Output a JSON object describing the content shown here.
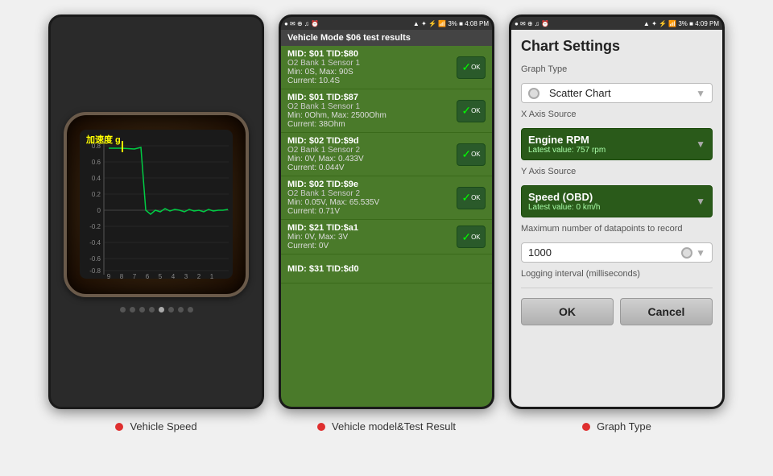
{
  "phone1": {
    "chart_title": "加速度 g",
    "y_labels": [
      "0.8",
      "0.6",
      "0.4",
      "0.2",
      "0",
      "−0.2",
      "−0.4",
      "−0.6",
      "−0.8"
    ],
    "x_labels": [
      "9",
      "8",
      "7",
      "6",
      "5",
      "4",
      "3",
      "2",
      "1"
    ],
    "dots": [
      false,
      false,
      false,
      false,
      true,
      false,
      false,
      false
    ]
  },
  "phone2": {
    "status_left": "●  ✉",
    "status_time": "4:08 PM",
    "status_signal": "3%■",
    "header": "Vehicle Mode $06 test results",
    "items": [
      {
        "mid": "MID: $01 TID:$80",
        "sensor": "O2 Bank 1 Sensor 1",
        "min_max": "Min: 0S, Max: 90S",
        "current": "Current: 10.4S",
        "has_ok": true
      },
      {
        "mid": "MID: $01 TID:$87",
        "sensor": "O2 Bank 1 Sensor 1",
        "min_max": "Min: 0Ohm, Max: 2500Ohm",
        "current": "Current: 38Ohm",
        "has_ok": true
      },
      {
        "mid": "MID: $02 TID:$9d",
        "sensor": "O2 Bank 1 Sensor 2",
        "min_max": "Min: 0V, Max: 0.433V",
        "current": "Current: 0.044V",
        "has_ok": true
      },
      {
        "mid": "MID: $02 TID:$9e",
        "sensor": "O2 Bank 1 Sensor 2",
        "min_max": "Min: 0.05V, Max: 65.535V",
        "current": "Current: 0.71V",
        "has_ok": true
      },
      {
        "mid": "MID: $21 TID:$a1",
        "sensor": "",
        "min_max": "Min: 0V, Max: 3V",
        "current": "Current: 0V",
        "has_ok": true
      },
      {
        "mid": "MID: $31 TID:$d0",
        "sensor": "",
        "min_max": "",
        "current": "",
        "has_ok": false
      }
    ]
  },
  "phone3": {
    "status_left": "●  ✉",
    "status_time": "4:09 PM",
    "status_signal": "3%■",
    "title": "Chart Settings",
    "graph_type_label": "Graph Type",
    "graph_type_value": "Scatter Chart",
    "x_axis_label": "X Axis Source",
    "x_axis_value": "Engine RPM",
    "x_axis_sub": "Latest value: 757 rpm",
    "y_axis_label": "Y Axis Source",
    "y_axis_value": "Speed (OBD)",
    "y_axis_sub": "Latest value: 0 km/h",
    "max_datapoints_label": "Maximum number of datapoints to record",
    "max_datapoints_value": "1000",
    "log_interval_label": "Logging interval (milliseconds)",
    "ok_label": "OK",
    "cancel_label": "Cancel"
  },
  "labels": [
    {
      "text": "Vehicle Speed"
    },
    {
      "text": "Vehicle model&Test Result"
    },
    {
      "text": "Graph Type"
    }
  ]
}
